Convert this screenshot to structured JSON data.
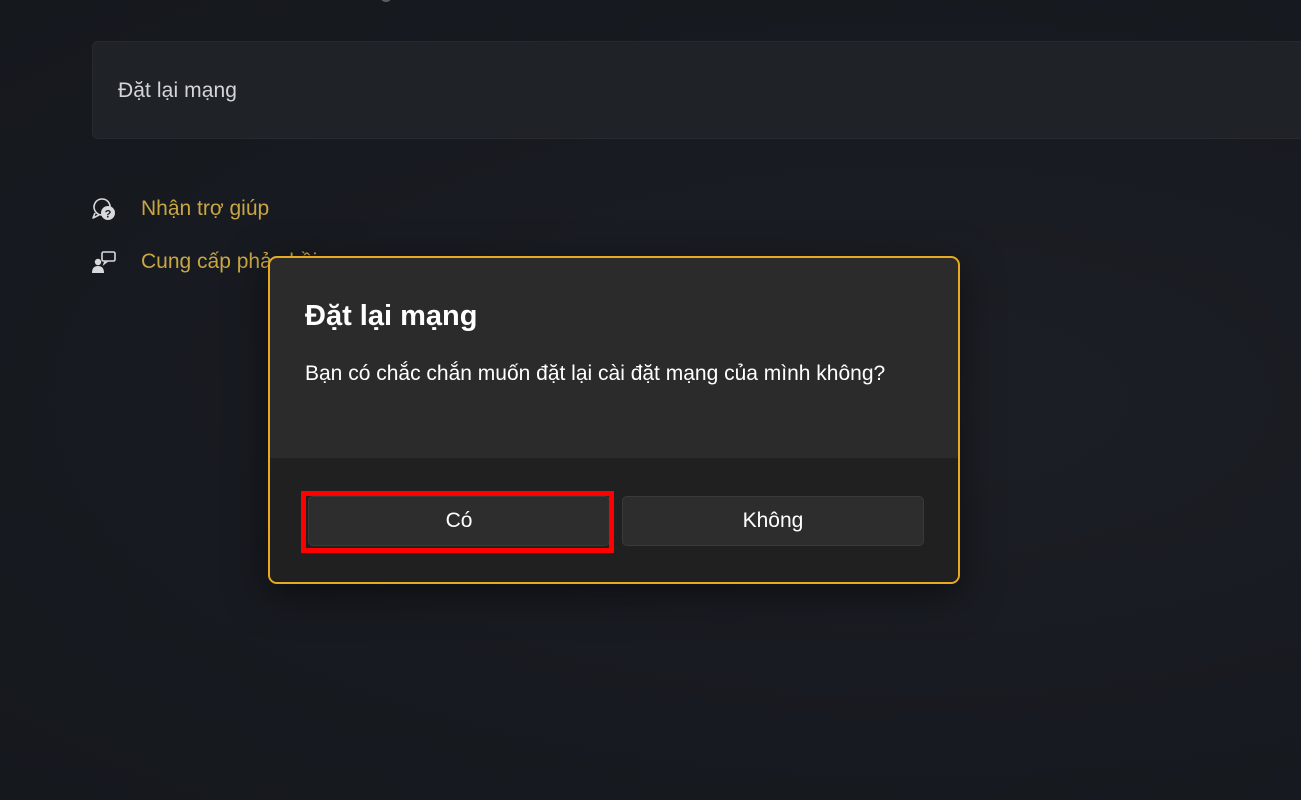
{
  "reset_card": {
    "label": "Đặt lại mạng"
  },
  "links": {
    "help_label": "Nhận trợ giúp",
    "feedback_label": "Cung cấp phản hồi"
  },
  "dialog": {
    "title": "Đặt lại mạng",
    "message": "Bạn có chắc chắn muốn đặt lại cài đặt mạng của mình không?",
    "yes_label": "Có",
    "no_label": "Không"
  },
  "colors": {
    "background": "#181b21",
    "card": "#1f2227",
    "link": "#c8a642",
    "dialog_border": "#e7a91f",
    "highlight": "#ff0000"
  },
  "icons": {
    "help": "help-chat-icon",
    "feedback": "feedback-person-icon"
  }
}
